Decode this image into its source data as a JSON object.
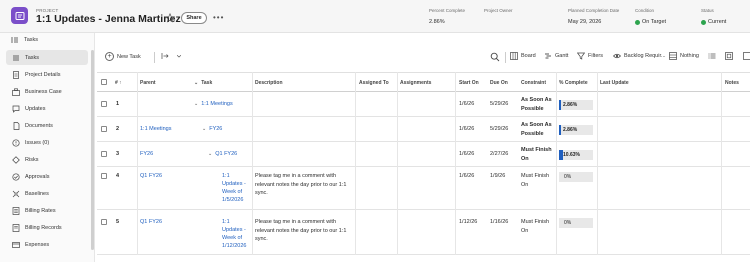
{
  "header": {
    "kicker": "PROJECT",
    "title": "1:1 Updates - Jenna Martinez",
    "share_label": "Share",
    "more_label": "•••",
    "percent_complete_label": "Percent Complete",
    "percent_complete_value": "2.86%",
    "project_owner_label": "Project Owner",
    "project_owner_value": "",
    "planned_completion_label": "Planned Completion Date",
    "planned_completion_value": "May 29, 2026",
    "condition_label": "Condition",
    "condition_value": "On Target",
    "status_label": "Status",
    "status_value": "Current",
    "status_color": "#2da44e"
  },
  "sidebar": {
    "collapse_label": "Tasks",
    "items": [
      {
        "label": "Tasks",
        "icon": "tasks-icon",
        "active": true
      },
      {
        "label": "Project Details",
        "icon": "document-icon"
      },
      {
        "label": "Business Case",
        "icon": "business-case-icon"
      },
      {
        "label": "Updates",
        "icon": "chat-icon"
      },
      {
        "label": "Documents",
        "icon": "folder-icon"
      },
      {
        "label": "Issues (0)",
        "icon": "issues-icon"
      },
      {
        "label": "Risks",
        "icon": "risk-icon"
      },
      {
        "label": "Approvals",
        "icon": "approval-icon"
      },
      {
        "label": "Baselines",
        "icon": "baseline-icon"
      },
      {
        "label": "Billing Rates",
        "icon": "billing-rates-icon"
      },
      {
        "label": "Billing Records",
        "icon": "billing-records-icon"
      },
      {
        "label": "Expenses",
        "icon": "expenses-icon"
      }
    ]
  },
  "toolbar": {
    "new_task_label": "New Task",
    "board_label": "Board",
    "gantt_label": "Gantt",
    "filters_label": "Filters",
    "backlog_label": "Backlog Requir...",
    "nothing_label": "Nothing"
  },
  "table": {
    "columns": {
      "num": "#",
      "sort_indicator": "↑",
      "parent": "Parent",
      "task": "Task",
      "description": "Description",
      "assigned_to": "Assigned To",
      "assignments": "Assignments",
      "start_on": "Start On",
      "due_on": "Due On",
      "constraint": "Constraint",
      "percent_complete": "% Complete",
      "last_update": "Last Update",
      "notes": "Notes"
    },
    "rows": [
      {
        "num": "1",
        "parent": "",
        "task": "1:1 Meetings",
        "description": "",
        "start": "1/6/26",
        "due": "5/29/26",
        "constraint": "As Soon As Possible",
        "pct": "2.86%",
        "pct_value": 2.86
      },
      {
        "num": "2",
        "parent": "1:1 Meetings",
        "task": "FY26",
        "description": "",
        "start": "1/6/26",
        "due": "5/29/26",
        "constraint": "As Soon As Possible",
        "pct": "2.86%",
        "pct_value": 2.86
      },
      {
        "num": "3",
        "parent": "FY26",
        "task": "Q1 FY26",
        "description": "",
        "start": "1/6/26",
        "due": "2/27/26",
        "constraint": "Must Finish On",
        "pct": "10.63%",
        "pct_value": 10.63
      },
      {
        "num": "4",
        "parent": "Q1 FY26",
        "task": "1:1 Updates - Week of 1/5/2026",
        "description": "Please tag me in a comment with relevant notes the day prior to our 1:1 sync.",
        "start": "1/6/26",
        "due": "1/9/26",
        "constraint": "Must Finish On",
        "pct": "0%",
        "pct_value": 0
      },
      {
        "num": "5",
        "parent": "Q1 FY26",
        "task": "1:1 Updates - Week of 1/12/2026",
        "description": "Please tag me in a comment with relevant notes the day prior to our 1:1 sync.",
        "start": "1/12/26",
        "due": "1/16/26",
        "constraint": "Must Finish On",
        "pct": "0%",
        "pct_value": 0
      }
    ]
  }
}
